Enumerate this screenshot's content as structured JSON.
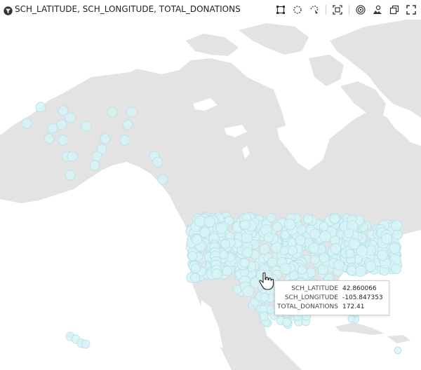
{
  "header": {
    "title": "SCH_LATITUDE, SCH_LONGITUDE, TOTAL_DONATIONS",
    "title_icon": "funnel-icon"
  },
  "toolbar": {
    "tools": [
      {
        "name": "rectangle-select-icon"
      },
      {
        "name": "lasso-select-icon"
      },
      {
        "name": "freeform-select-icon"
      },
      {
        "name": "zoom-to-fit-icon"
      },
      {
        "name": "target-icon"
      },
      {
        "name": "map-layers-icon"
      },
      {
        "name": "copy-icon"
      },
      {
        "name": "fullscreen-icon"
      }
    ]
  },
  "map": {
    "land_color": "#e3e3e3",
    "water_color": "#ffffff",
    "point_fill": "#d8f3f6",
    "point_stroke": "#b9e3ea"
  },
  "tooltip": {
    "rows": [
      {
        "label": "SCH_LATITUDE",
        "value": "42.860066"
      },
      {
        "label": "SCH_LONGITUDE",
        "value": "-105.847353"
      },
      {
        "label": "TOTAL_DONATIONS",
        "value": "172.41"
      }
    ]
  }
}
